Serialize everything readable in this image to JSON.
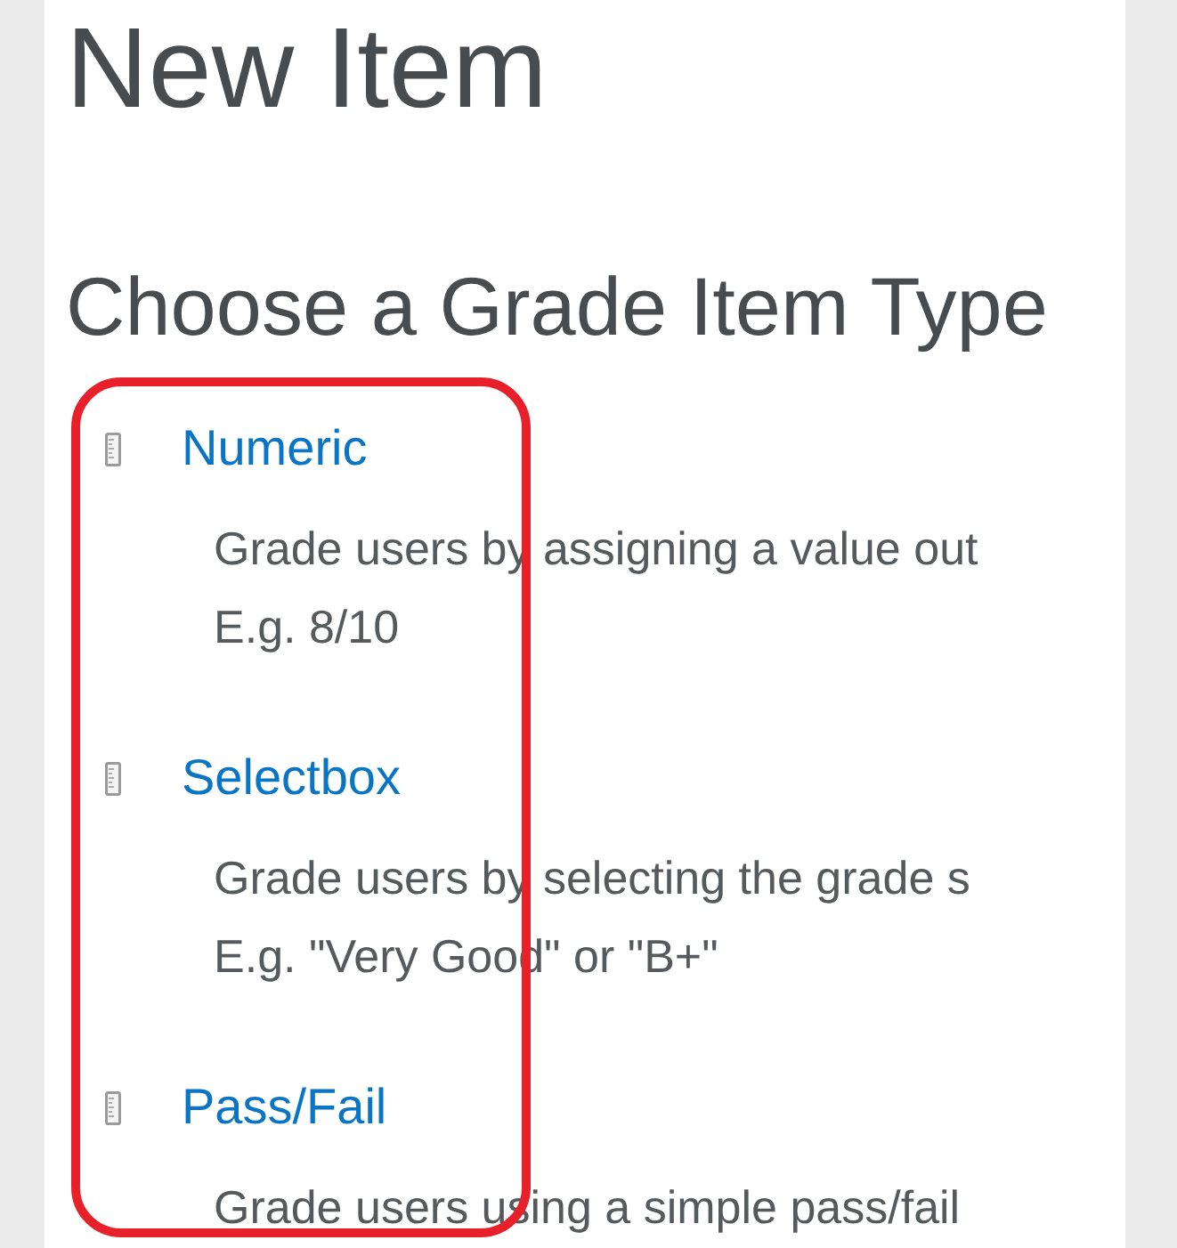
{
  "page": {
    "title": "New Item",
    "subtitle": "Choose a Grade Item Type"
  },
  "grade_types": [
    {
      "label": "Numeric",
      "description": [
        "Grade users by assigning a value out",
        "E.g. 8/10"
      ]
    },
    {
      "label": "Selectbox",
      "description": [
        "Grade users by selecting the grade s",
        "E.g. \"Very Good\" or \"B+\""
      ]
    },
    {
      "label": "Pass/Fail",
      "description": [
        "Grade users using a simple pass/fail"
      ]
    }
  ]
}
